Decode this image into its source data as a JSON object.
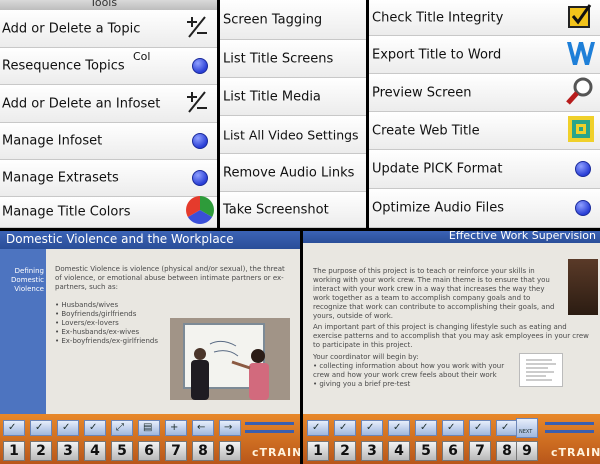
{
  "top_left_panel": {
    "header": "Tools",
    "items": [
      {
        "label": "Add or Delete a Topic",
        "icon": "plus-minus-icon"
      },
      {
        "label": "Resequence Topics",
        "icon": "blue-circle-icon",
        "overlay": "Col"
      },
      {
        "label": "Add or Delete an Infoset",
        "icon": "plus-minus-icon"
      },
      {
        "label": "Manage Infoset",
        "icon": "blue-circle-icon"
      },
      {
        "label": "Manage Extrasets",
        "icon": "blue-circle-icon"
      },
      {
        "label": "Manage Title Colors",
        "icon": "color-wheel-icon"
      }
    ]
  },
  "top_middle_panel": {
    "items": [
      {
        "label": "Screen Tagging"
      },
      {
        "label": "List Title Screens"
      },
      {
        "label": "List Title Media"
      },
      {
        "label": "List All Video Settings"
      },
      {
        "label": "Remove Audio Links"
      },
      {
        "label": "Take Screenshot"
      }
    ]
  },
  "top_right_panel": {
    "items": [
      {
        "label": "Check Title Integrity",
        "icon": "checkbox-icon"
      },
      {
        "label": "Export Title to Word",
        "icon": "word-icon"
      },
      {
        "label": "Preview Screen",
        "icon": "magnifier-icon"
      },
      {
        "label": "Create Web Title",
        "icon": "web-title-icon"
      },
      {
        "label": "Update PICK Format",
        "icon": "blue-circle-icon"
      },
      {
        "label": "Optimize Audio Files",
        "icon": "blue-circle-icon"
      }
    ]
  },
  "slide_left": {
    "title": "Domestic Violence and the Workplace",
    "sidebar_label": "Defining Domestic Violence",
    "intro": "Domestic Violence is violence (physical and/or sexual), the threat of violence, or emotional abuse between intimate partners or ex-partners, such as:",
    "bullets": [
      "• Husbands/wives",
      "• Boyfriends/girlfriends",
      "• Lovers/ex-lovers",
      "• Ex-husbands/ex-wives",
      "• Ex-boyfriends/ex-girlfriends"
    ],
    "brand": "cTRAIN",
    "page_numbers": [
      "1",
      "2",
      "3",
      "4",
      "5",
      "6",
      "7",
      "8",
      "9"
    ]
  },
  "slide_right": {
    "title": "Effective Work Supervision",
    "para1": "The purpose of this project is to teach or reinforce your skills in working with your work crew. The main theme is to ensure that you interact with your work crew in a way that increases the way they work together as a team to accomplish company goals and to recognize that work can contribute to accomplishing their goals, and yours, outside of work.",
    "para2": "An important part of this project is changing lifestyle such as eating and exercise patterns and to accomplish that you may ask employees in your crew to participate in this project.",
    "para3": "Your coordinator will begin by:",
    "bullets": [
      "• collecting information about how you work with your crew and how your work crew feels about their work",
      "• giving you a brief pre-test"
    ],
    "next_label": "NEXT",
    "brand": "cTRAIN",
    "page_numbers": [
      "1",
      "2",
      "3",
      "4",
      "5",
      "6",
      "7",
      "8",
      "9"
    ]
  },
  "colors": {
    "slide_title_blue": "#3b63b6",
    "footer_orange": "#d9762a",
    "accent_blue": "#2a3fd6"
  }
}
